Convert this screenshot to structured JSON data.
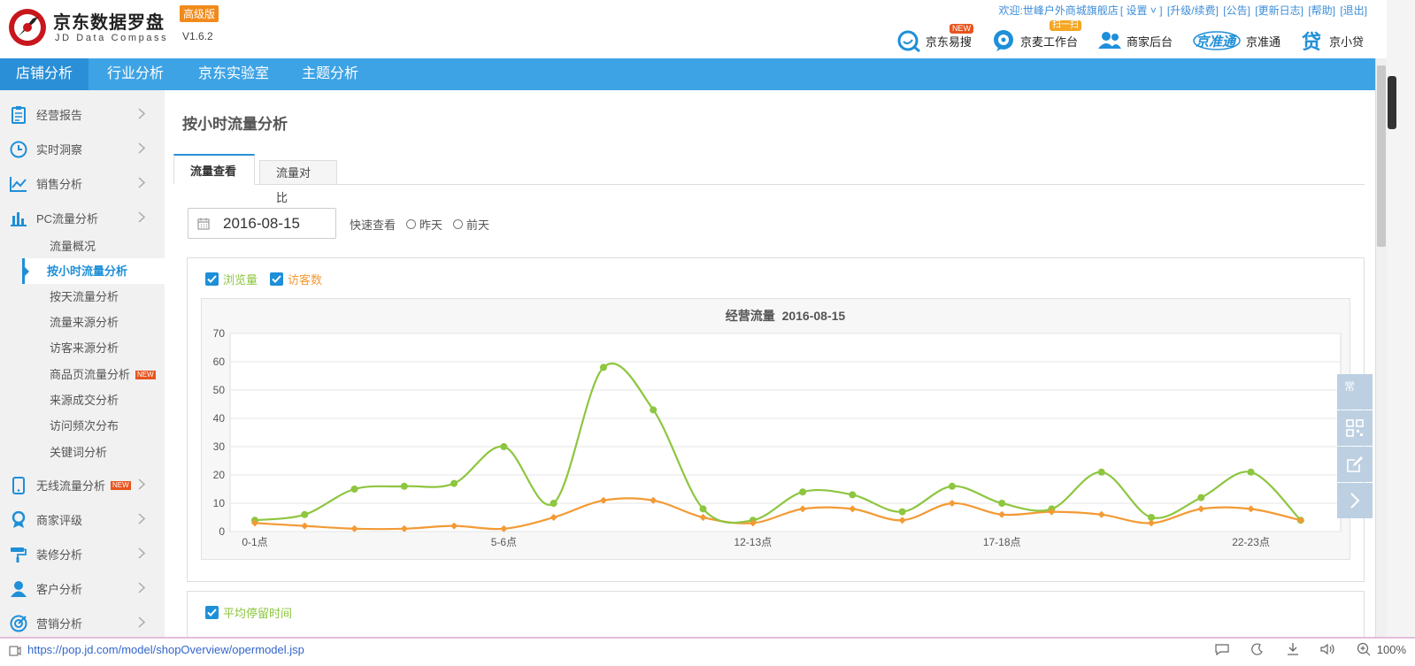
{
  "app": {
    "logo_title": "京东数据罗盘",
    "edition": "高级版",
    "subtitle": "JD Data Compass",
    "version": "V1.6.2"
  },
  "toplinks": {
    "welcome": "欢迎:世峰户外商城旗舰店",
    "settings": "[ 设置 ˅ ]",
    "upgrade": "[升级/续费]",
    "notice": "[公告]",
    "changelog": "[更新日志]",
    "help": "[帮助]",
    "logout": "[退出]"
  },
  "toolbar": [
    {
      "label": "京东易搜",
      "badge": "NEW",
      "icon": "search-bubble-icon"
    },
    {
      "label": "京麦工作台",
      "badge": "扫一扫",
      "icon": "jingmai-icon"
    },
    {
      "label": "商家后台",
      "badge": "",
      "icon": "users-icon"
    },
    {
      "label": "京准通",
      "badge": "",
      "icon": "jingzhuntong-logo-icon"
    },
    {
      "label": "京小贷",
      "badge": "",
      "icon": "loan-icon"
    }
  ],
  "nav": [
    "店铺分析",
    "行业分析",
    "京东实验室",
    "主题分析"
  ],
  "sidebar": {
    "main": [
      {
        "label": "经营报告",
        "icon": "report-icon"
      },
      {
        "label": "实时洞察",
        "icon": "clock-icon"
      },
      {
        "label": "销售分析",
        "icon": "line-chart-icon"
      },
      {
        "label": "PC流量分析",
        "icon": "bar-chart-icon"
      },
      {
        "label": "无线流量分析",
        "icon": "mobile-icon",
        "badge": "NEW"
      },
      {
        "label": "商家评级",
        "icon": "ribbon-icon"
      },
      {
        "label": "装修分析",
        "icon": "paint-roller-icon"
      },
      {
        "label": "客户分析",
        "icon": "user-icon"
      },
      {
        "label": "营销分析",
        "icon": "target-icon"
      }
    ],
    "sub": [
      {
        "label": "流量概况"
      },
      {
        "label": "按小时流量分析",
        "active": true
      },
      {
        "label": "按天流量分析"
      },
      {
        "label": "流量来源分析"
      },
      {
        "label": "访客来源分析"
      },
      {
        "label": "商品页流量分析",
        "badge": "NEW"
      },
      {
        "label": "来源成交分析"
      },
      {
        "label": "访问频次分布"
      },
      {
        "label": "关键词分析"
      }
    ]
  },
  "page": {
    "title": "按小时流量分析",
    "tabs": [
      "流量查看",
      "流量对比"
    ],
    "date": "2016-08-15",
    "quick_label": "快速查看",
    "quick_options": [
      "昨天",
      "前天"
    ],
    "legend": [
      {
        "label": "浏览量",
        "color": "#8dc63f"
      },
      {
        "label": "访客数",
        "color": "#f39a35"
      }
    ],
    "panel2_legend": "平均停留时间"
  },
  "chart_data": {
    "type": "line",
    "title": "经营流量  2016-08-15",
    "categories": [
      "0-1点",
      "1-2点",
      "2-3点",
      "3-4点",
      "4-5点",
      "5-6点",
      "6-7点",
      "7-8点",
      "8-9点",
      "9-10点",
      "10-11点",
      "11-12点",
      "12-13点",
      "13-14点",
      "14-15点",
      "15-16点",
      "16-17点",
      "17-18点",
      "18-19点",
      "19-20点",
      "20-21点",
      "21-22点",
      "22-23点",
      "23-24点"
    ],
    "tick_labels": [
      "0-1点",
      "5-6点",
      "12-13点",
      "17-18点",
      "22-23点"
    ],
    "tick_indices": [
      0,
      5,
      10,
      15,
      20
    ],
    "series": [
      {
        "name": "浏览量",
        "color": "#8dc63f",
        "values": [
          4,
          6,
          15,
          16,
          17,
          30,
          10,
          58,
          43,
          8,
          4,
          14,
          13,
          7,
          16,
          10,
          8,
          21,
          5,
          12,
          21,
          4
        ]
      },
      {
        "name": "访客数",
        "color": "#f39a35",
        "values": [
          3,
          2,
          1,
          1,
          2,
          1,
          5,
          11,
          11,
          5,
          3,
          8,
          8,
          4,
          10,
          6,
          7,
          6,
          3,
          8,
          8,
          4
        ]
      }
    ],
    "ylim": [
      0,
      70
    ],
    "yticks": [
      0,
      10,
      20,
      30,
      40,
      50,
      60,
      70
    ],
    "grid": true
  },
  "float_buttons": [
    {
      "label": "常",
      "icon": "frequent-icon"
    },
    {
      "label": "",
      "icon": "qrcode-icon"
    },
    {
      "label": "",
      "icon": "edit-icon"
    },
    {
      "label": "",
      "icon": "chevron-right-icon"
    }
  ],
  "statusbar": {
    "url": "https://pop.jd.com/model/shopOverview/opermodel.jsp",
    "zoom": "100%"
  }
}
